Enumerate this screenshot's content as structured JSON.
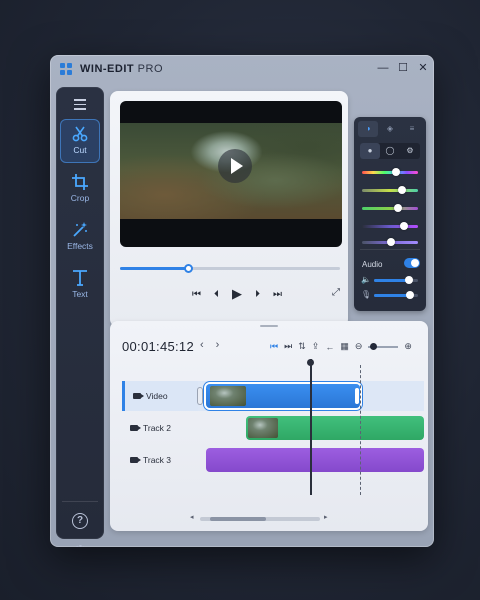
{
  "app": {
    "title_main": "WIN-EDIT",
    "title_sub": "PRO"
  },
  "window_controls": {
    "minimize": "—",
    "maximize": "☐",
    "close": "✕"
  },
  "rail": {
    "tools": [
      {
        "label": "Cut",
        "icon": "scissors-icon",
        "active": true
      },
      {
        "label": "Crop",
        "icon": "crop-icon",
        "active": false
      },
      {
        "label": "Effects",
        "icon": "magic-wand-icon",
        "active": false
      },
      {
        "label": "Text",
        "icon": "text-icon",
        "active": false
      }
    ],
    "help_glyph": "?"
  },
  "preview": {
    "progress": 0.31,
    "transport": {
      "skip_back": "⏮",
      "prev": "⏴",
      "play": "▶",
      "next": "⏵",
      "skip_fwd": "⏭"
    },
    "expand_glyph": "⤢"
  },
  "adjust": {
    "tabs": [
      "◑",
      "◈",
      "≡"
    ],
    "modes": [
      "●",
      "◯",
      "⚙"
    ],
    "sliders": [
      {
        "name": "hue",
        "value": 0.6,
        "gradient": "linear-gradient(90deg,#ff4d4d,#ffd84d,#4dff6a,#4dc8ff,#8a4dff,#ff4dd2)"
      },
      {
        "name": "saturation",
        "value": 0.72,
        "gradient": "linear-gradient(90deg,#7a8a6a,#c6e04a,#4dd0a8)"
      },
      {
        "name": "temperature",
        "value": 0.65,
        "gradient": "linear-gradient(90deg,#4dd06a,#8ad04a,#a34dd6)"
      },
      {
        "name": "tint",
        "value": 0.75,
        "gradient": "linear-gradient(90deg,#2a2f3c,#6a5acd,#b44dff)"
      },
      {
        "name": "exposure",
        "value": 0.52,
        "gradient": "linear-gradient(90deg,#4a5367,#7d6ad8,#a28cff)"
      }
    ],
    "audio_label": "Audio",
    "audio_on": true,
    "volume": 0.8,
    "mic_level": 0.82,
    "volume_icon": "🔈",
    "mic_icon": "🎙"
  },
  "timeline": {
    "timecode": "00:01:45:12",
    "nav_prev": "‹",
    "nav_next": "›",
    "tools": [
      "⏮",
      "⏭",
      "⇅",
      "⇪",
      "←",
      "▦",
      "⊖",
      "⊕"
    ],
    "tracks": [
      {
        "label": "Video",
        "selected": true,
        "color": "#2f82e6"
      },
      {
        "label": "Track 2",
        "selected": false,
        "color": "#3bb773"
      },
      {
        "label": "Track 3",
        "selected": false,
        "color": "#9255da"
      }
    ]
  }
}
